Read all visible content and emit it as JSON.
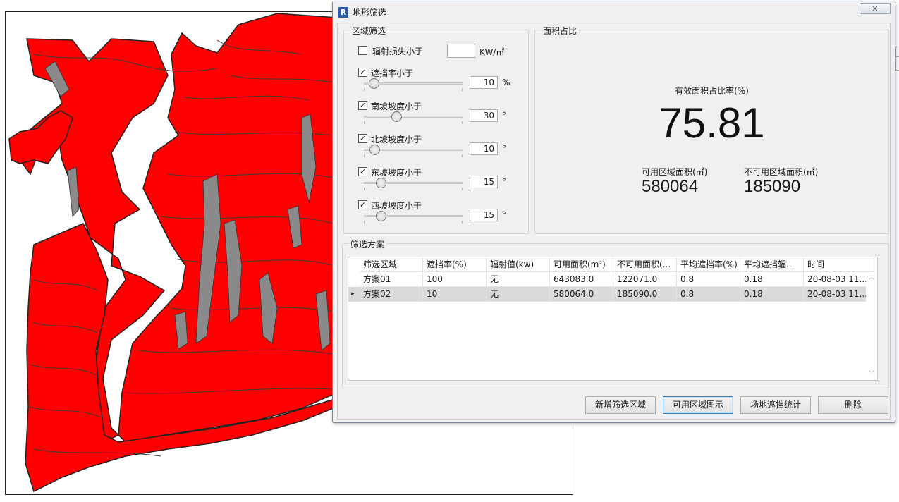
{
  "window": {
    "title": "地形筛选",
    "app_icon_letter": "R",
    "close_glyph": "✕"
  },
  "region_filter": {
    "legend": "区域筛选",
    "radiation": {
      "label": "辐射损失小于",
      "checked": false,
      "value": "",
      "unit": "KW/㎡"
    },
    "sliders": [
      {
        "label": "遮挡率小于",
        "checked": true,
        "value": "10",
        "unit": "%",
        "position": 0.1
      },
      {
        "label": "南坡坡度小于",
        "checked": true,
        "value": "30",
        "unit": "°",
        "position": 0.33
      },
      {
        "label": "北坡坡度小于",
        "checked": true,
        "value": "10",
        "unit": "°",
        "position": 0.11
      },
      {
        "label": "东坡坡度小于",
        "checked": true,
        "value": "15",
        "unit": "°",
        "position": 0.17
      },
      {
        "label": "西坡坡度小于",
        "checked": true,
        "value": "15",
        "unit": "°",
        "position": 0.17
      }
    ]
  },
  "area_ratio": {
    "legend": "面积占比",
    "ratio_label": "有效面积占比率(%)",
    "ratio_value": "75.81",
    "usable_label": "可用区域面积(㎡)",
    "usable_value": "580064",
    "unusable_label": "不可用区域面积(㎡)",
    "unusable_value": "185090"
  },
  "schemes": {
    "legend": "筛选方案",
    "columns": [
      "筛选区域",
      "遮挡率(%)",
      "辐射值(kw)",
      "可用面积(m²)",
      "不可用面积(...",
      "平均遮挡率(%)",
      "平均遮挡辐...",
      "时间"
    ],
    "rows": [
      [
        "方案01",
        "100",
        "无",
        "643083.0",
        "122071.0",
        "0.8",
        "0.18",
        "20-08-03 11..."
      ],
      [
        "方案02",
        "10",
        "无",
        "580064.0",
        "185090.0",
        "0.8",
        "0.18",
        "20-08-03 11..."
      ]
    ],
    "selected_marker": "▸"
  },
  "buttons": {
    "add": "新增筛选区域",
    "show": "可用区域图示",
    "stats": "场地遮挡统计",
    "delete": "删除"
  },
  "colors": {
    "terrain": "#ff0000",
    "contour": "#3a3a3a",
    "steep": "#8a8a8a"
  }
}
